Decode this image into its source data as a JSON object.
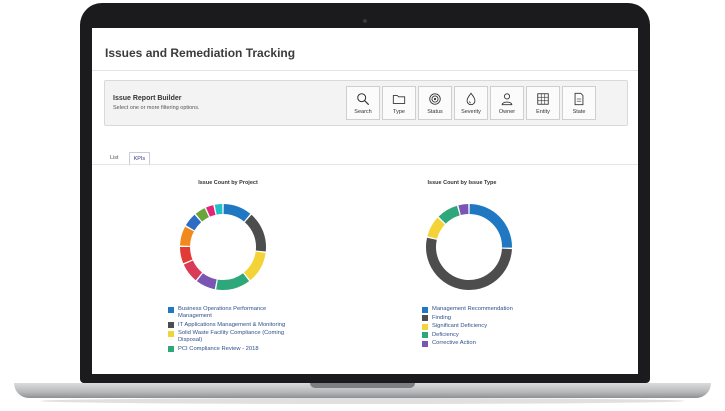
{
  "page": {
    "title": "Issues and Remediation Tracking"
  },
  "builder": {
    "title": "Issue Report Builder",
    "subtitle": "Select one or more filtering options.",
    "buttons": [
      {
        "label": "Search",
        "icon": "search-icon"
      },
      {
        "label": "Type",
        "icon": "folder-icon"
      },
      {
        "label": "Status",
        "icon": "target-icon"
      },
      {
        "label": "Severity",
        "icon": "drop-icon"
      },
      {
        "label": "Owner",
        "icon": "person-icon"
      },
      {
        "label": "Entity",
        "icon": "grid-icon"
      },
      {
        "label": "State",
        "icon": "document-icon"
      }
    ]
  },
  "tabs": [
    {
      "label": "List",
      "active": false
    },
    {
      "label": "KPIs",
      "active": true
    }
  ],
  "chart_data": [
    {
      "type": "pie",
      "title": "Issue Count by Project",
      "series": [
        {
          "name": "Business Operations Performance Management",
          "value": 10,
          "color": "#1f78c1"
        },
        {
          "name": "IT Applications Management & Monitoring",
          "value": 14,
          "color": "#4d4d4d"
        },
        {
          "name": "Solid Waste Facility Compliance (Coming Disposal)",
          "value": 11,
          "color": "#f4d338"
        },
        {
          "name": "PCI Compliance Review - 2018",
          "value": 12,
          "color": "#2ea77a"
        },
        {
          "name": "",
          "value": 7,
          "color": "#7a55b3"
        },
        {
          "name": "",
          "value": 7,
          "color": "#d93a55"
        },
        {
          "name": "",
          "value": 6,
          "color": "#e23b35"
        },
        {
          "name": "",
          "value": 7,
          "color": "#f08a1c"
        },
        {
          "name": "",
          "value": 5,
          "color": "#2f6cc4"
        },
        {
          "name": "",
          "value": 4,
          "color": "#6ba539"
        },
        {
          "name": "",
          "value": 3,
          "color": "#e0267a"
        },
        {
          "name": "",
          "value": 3,
          "color": "#22c0c9"
        }
      ]
    },
    {
      "type": "pie",
      "title": "Issue Count by Issue Type",
      "series": [
        {
          "name": "Management Recommendation",
          "value": 24,
          "color": "#1f78c1"
        },
        {
          "name": "Finding",
          "value": 50,
          "color": "#4d4d4d"
        },
        {
          "name": "Significant Deficiency",
          "value": 8,
          "color": "#f4d338"
        },
        {
          "name": "Deficiency",
          "value": 8,
          "color": "#2ea77a"
        },
        {
          "name": "Corrective Action",
          "value": 4,
          "color": "#7a55b3"
        }
      ]
    }
  ]
}
